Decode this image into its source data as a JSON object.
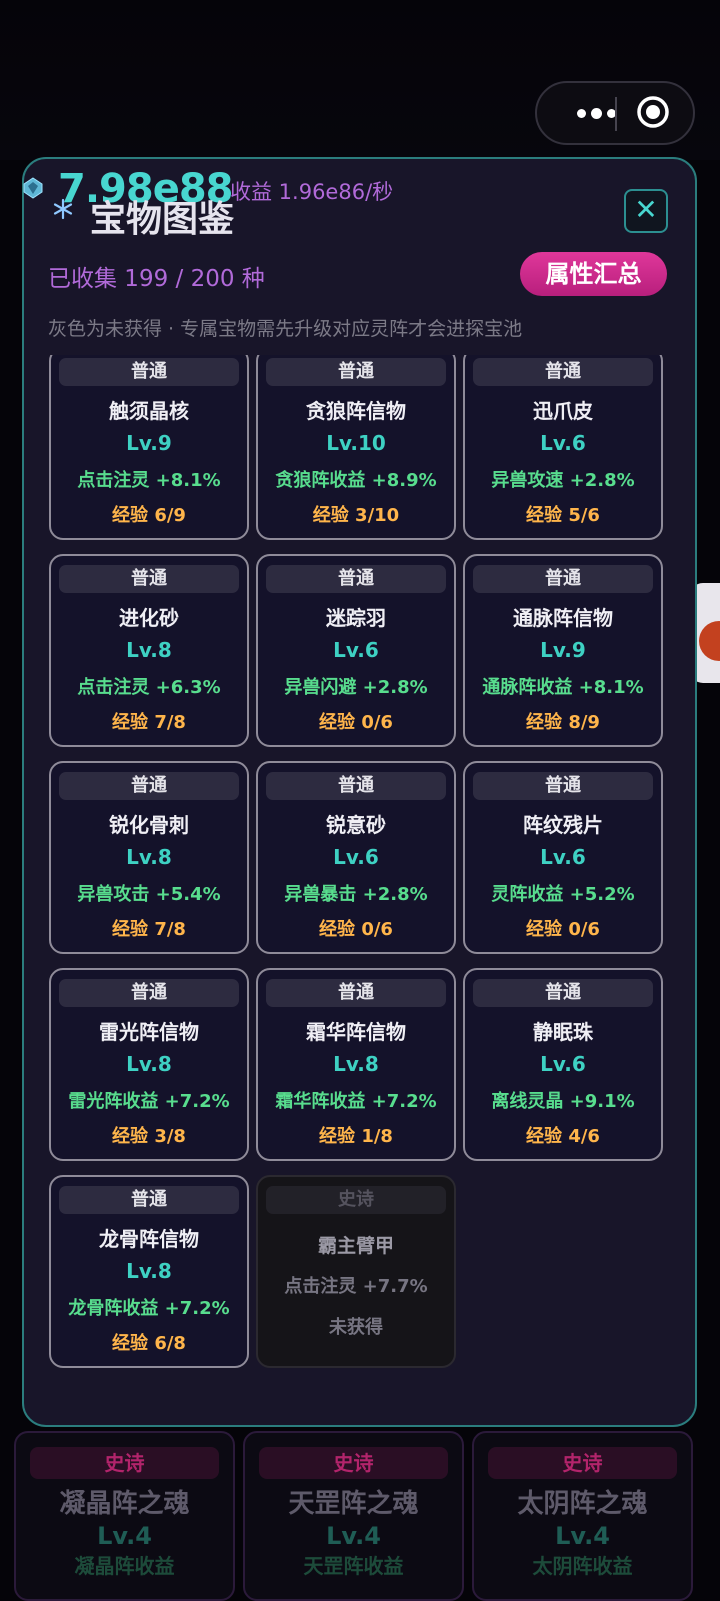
{
  "currency": {
    "value": "7.98e88",
    "income": "收益 1.96e86/秒"
  },
  "modal": {
    "title": "宝物图鉴",
    "collected": "已收集 199 / 200 种",
    "summary_button": "属性汇总",
    "hint": "灰色为未获得 · 专属宝物需先升级对应灵阵才会进探宝池",
    "close_icon": "close-icon"
  },
  "treasures": [
    {
      "tag": "普通",
      "name": "触须晶核",
      "level": "Lv.9",
      "effect": "点击注灵 +8.1%",
      "exp": "经验 6/9"
    },
    {
      "tag": "普通",
      "name": "贪狼阵信物",
      "level": "Lv.10",
      "effect": "贪狼阵收益 +8.9%",
      "exp": "经验 3/10"
    },
    {
      "tag": "普通",
      "name": "迅爪皮",
      "level": "Lv.6",
      "effect": "异兽攻速 +2.8%",
      "exp": "经验 5/6"
    },
    {
      "tag": "普通",
      "name": "进化砂",
      "level": "Lv.8",
      "effect": "点击注灵 +6.3%",
      "exp": "经验 7/8"
    },
    {
      "tag": "普通",
      "name": "迷踪羽",
      "level": "Lv.6",
      "effect": "异兽闪避 +2.8%",
      "exp": "经验 0/6"
    },
    {
      "tag": "普通",
      "name": "通脉阵信物",
      "level": "Lv.9",
      "effect": "通脉阵收益 +8.1%",
      "exp": "经验 8/9"
    },
    {
      "tag": "普通",
      "name": "锐化骨刺",
      "level": "Lv.8",
      "effect": "异兽攻击 +5.4%",
      "exp": "经验 7/8"
    },
    {
      "tag": "普通",
      "name": "锐意砂",
      "level": "Lv.6",
      "effect": "异兽暴击 +2.8%",
      "exp": "经验 0/6"
    },
    {
      "tag": "普通",
      "name": "阵纹残片",
      "level": "Lv.6",
      "effect": "灵阵收益 +5.2%",
      "exp": "经验 0/6"
    },
    {
      "tag": "普通",
      "name": "雷光阵信物",
      "level": "Lv.8",
      "effect": "雷光阵收益 +7.2%",
      "exp": "经验 3/8"
    },
    {
      "tag": "普通",
      "name": "霜华阵信物",
      "level": "Lv.8",
      "effect": "霜华阵收益 +7.2%",
      "exp": "经验 1/8"
    },
    {
      "tag": "普通",
      "name": "静眠珠",
      "level": "Lv.6",
      "effect": "离线灵晶 +9.1%",
      "exp": "经验 4/6"
    },
    {
      "tag": "普通",
      "name": "龙骨阵信物",
      "level": "Lv.8",
      "effect": "龙骨阵收益 +7.2%",
      "exp": "经验 6/8"
    }
  ],
  "locked_treasure": {
    "tag": "史诗",
    "name": "霸主臂甲",
    "effect": "点击注灵 +7.7%",
    "status": "未获得"
  },
  "background_cards": [
    {
      "tag": "史诗",
      "name": "凝晶阵之魂",
      "level": "Lv.4",
      "effect": "凝晶阵收益"
    },
    {
      "tag": "史诗",
      "name": "天罡阵之魂",
      "level": "Lv.4",
      "effect": "天罡阵收益"
    },
    {
      "tag": "史诗",
      "name": "太阴阵之魂",
      "level": "Lv.4",
      "effect": "太阴阵收益"
    }
  ],
  "colors": {
    "accent_cyan": "#48d6d0",
    "accent_purple": "#b16ad9",
    "button_pink": "#d02c8c",
    "effect_green": "#58dd8e",
    "exp_orange": "#ffb54b"
  }
}
